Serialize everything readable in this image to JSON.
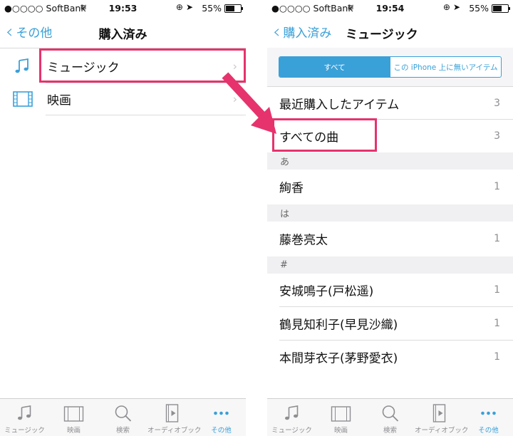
{
  "colors": {
    "accent": "#3aa0d8",
    "highlight": "#e6336d",
    "separator": "#dcdcdc"
  },
  "left": {
    "status": {
      "carrier": "●○○○○ SoftBank",
      "time": "19:53",
      "battery": "55%"
    },
    "nav": {
      "back": "その他",
      "title": "購入済み"
    },
    "rows": [
      {
        "icon": "music-note-icon",
        "label": "ミュージック"
      },
      {
        "icon": "film-icon",
        "label": "映画"
      }
    ]
  },
  "right": {
    "status": {
      "carrier": "●○○○○ SoftBank",
      "time": "19:54",
      "battery": "55%"
    },
    "nav": {
      "back": "購入済み",
      "title": "ミュージック"
    },
    "segments": {
      "all": "すべて",
      "not_on_device": "この iPhone 上に無いアイテム"
    },
    "top_rows": [
      {
        "label": "最近購入したアイテム",
        "count": "3"
      },
      {
        "label": "すべての曲",
        "count": "3"
      }
    ],
    "sections": [
      {
        "header": "あ",
        "rows": [
          {
            "label": "絢香",
            "count": "1"
          }
        ]
      },
      {
        "header": "は",
        "rows": [
          {
            "label": "藤巻亮太",
            "count": "1"
          }
        ]
      },
      {
        "header": "#",
        "rows": [
          {
            "label": "安城鳴子(戸松遥)",
            "count": "1"
          },
          {
            "label": "鶴見知利子(早見沙織)",
            "count": "1"
          },
          {
            "label": "本間芽衣子(茅野愛衣)",
            "count": "1"
          }
        ]
      }
    ]
  },
  "tabbar": [
    {
      "icon": "music-note-icon",
      "label": "ミュージック"
    },
    {
      "icon": "film-icon",
      "label": "映画"
    },
    {
      "icon": "search-icon",
      "label": "検索"
    },
    {
      "icon": "audiobook-icon",
      "label": "オーディオブック"
    },
    {
      "icon": "more-dots-icon",
      "label": "その他",
      "active": true
    }
  ]
}
